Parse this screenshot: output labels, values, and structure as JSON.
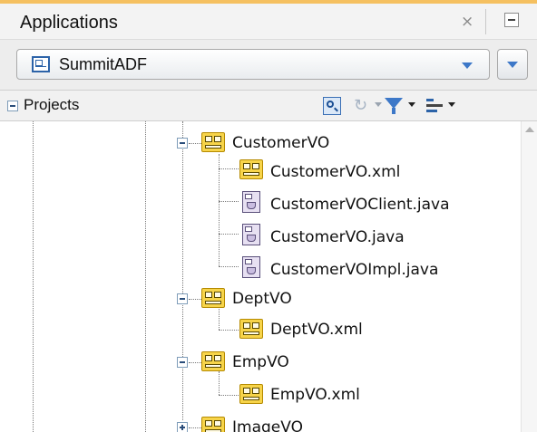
{
  "header": {
    "title": "Applications",
    "close_glyph": "×"
  },
  "app_selector": {
    "selected": "SummitADF"
  },
  "projects_bar": {
    "label": "Projects",
    "toolbar": [
      "find-icon",
      "sync-icon",
      "filter-icon",
      "sort-icon"
    ]
  },
  "tree": {
    "nodes": [
      {
        "label": "CustomerVO",
        "icon": "view-object-icon",
        "expanded": true
      },
      {
        "label": "CustomerVO.xml",
        "icon": "view-object-icon"
      },
      {
        "label": "CustomerVOClient.java",
        "icon": "java-file-icon"
      },
      {
        "label": "CustomerVO.java",
        "icon": "java-file-icon"
      },
      {
        "label": "CustomerVOImpl.java",
        "icon": "java-file-icon"
      },
      {
        "label": "DeptVO",
        "icon": "view-object-icon",
        "expanded": true
      },
      {
        "label": "DeptVO.xml",
        "icon": "view-object-icon"
      },
      {
        "label": "EmpVO",
        "icon": "view-object-icon",
        "expanded": true
      },
      {
        "label": "EmpVO.xml",
        "icon": "view-object-icon"
      },
      {
        "label": "ImageVO",
        "icon": "view-object-icon",
        "expanded": false
      }
    ]
  },
  "colors": {
    "header_accent": "#f5c060",
    "link_blue": "#3d78c8",
    "vo_icon": "#f7d44a"
  }
}
